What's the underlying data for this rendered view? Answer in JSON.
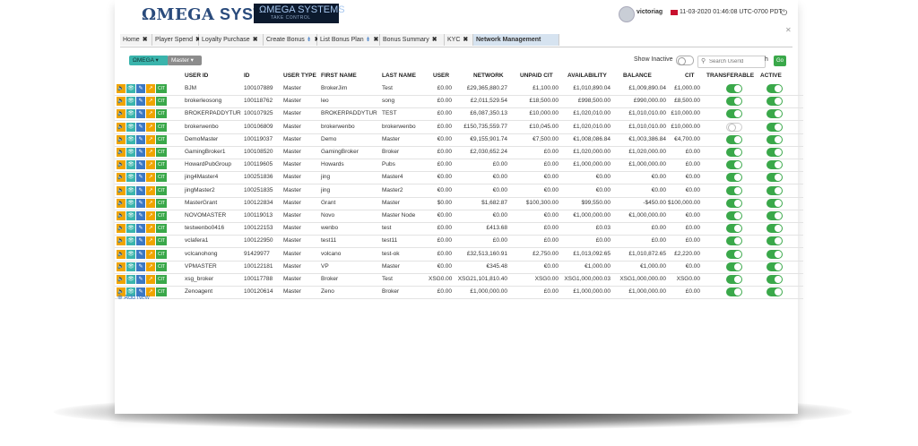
{
  "header": {
    "logo_text": "SYSTEMS",
    "logo_omega": "ΩMEGA",
    "badge_line1": "ΩMEGA SYSTEMS",
    "badge_line2": "TAKE CONTROL",
    "username": "victoriag",
    "datetime": "11-03-2020 01:46:08  UTC-0700 PDT",
    "power_icon": "⏻"
  },
  "tabs": [
    {
      "label": "Home",
      "pin": false,
      "active": false
    },
    {
      "label": "Player Spend",
      "pin": false,
      "active": false
    },
    {
      "label": "Loyalty Purchase",
      "pin": false,
      "active": false
    },
    {
      "label": "Create Bonus",
      "pin": true,
      "active": false
    },
    {
      "label": "List Bonus Plan",
      "pin": true,
      "active": false
    },
    {
      "label": "Bonus Summary",
      "pin": false,
      "active": false
    },
    {
      "label": "KYC",
      "pin": false,
      "active": false
    },
    {
      "label": "Network Management",
      "pin": false,
      "active": true
    }
  ],
  "toolbar": {
    "omega_dropdown": "ΩMEGA ▾",
    "master_dropdown": "Master ▾",
    "show_inactive": "Show Inactive",
    "search_placeholder": "Search UserId",
    "search_toggle": "h",
    "go_label": "Go"
  },
  "columns": [
    "USER ID",
    "ID",
    "USER TYPE",
    "FIRST NAME",
    "LAST NAME",
    "USER",
    "NETWORK",
    "UNPAID CIT",
    "AVAILABILITY",
    "BALANCE",
    "CIT",
    "TRANSFERABLE",
    "ACTIVE"
  ],
  "action_buttons": [
    "🔈",
    "👁",
    "✎",
    "↗",
    "CIT"
  ],
  "rows": [
    {
      "user_id": "BJM",
      "id": "100107889",
      "type": "Master",
      "first": "BrokerJim",
      "last": "Test",
      "user": "£0.00",
      "network": "£29,365,880.27",
      "unpaid": "£1,100.00",
      "avail": "£1,010,890.04",
      "balance": "£1,009,890.04",
      "cit": "£1,000.00",
      "transferable": true,
      "active": true
    },
    {
      "user_id": "brokerleosong",
      "id": "100118762",
      "type": "Master",
      "first": "leo",
      "last": "song",
      "user": "£0.00",
      "network": "£2,011,529.54",
      "unpaid": "£18,500.00",
      "avail": "£998,500.00",
      "balance": "£990,000.00",
      "cit": "£8,500.00",
      "transferable": true,
      "active": true
    },
    {
      "user_id": "BROKERPADDYTUR",
      "id": "100107925",
      "type": "Master",
      "first": "BROKERPADDYTUR",
      "last": "TEST",
      "user": "£0.00",
      "network": "£6,087,350.13",
      "unpaid": "£10,000.00",
      "avail": "£1,020,010.00",
      "balance": "£1,010,010.00",
      "cit": "£10,000.00",
      "transferable": true,
      "active": true
    },
    {
      "user_id": "brokerwenbo",
      "id": "100106809",
      "type": "Master",
      "first": "brokerwenbo",
      "last": "brokerwenbo",
      "user": "£0.00",
      "network": "£150,735,559.77",
      "unpaid": "£10,045.00",
      "avail": "£1,020,010.00",
      "balance": "£1,010,010.00",
      "cit": "£10,000.00",
      "transferable": false,
      "active": true
    },
    {
      "user_id": "DemoMaster",
      "id": "100119037",
      "type": "Master",
      "first": "Demo",
      "last": "Master",
      "user": "€0.00",
      "network": "€9,155,901.74",
      "unpaid": "€7,500.00",
      "avail": "€1,008,086.84",
      "balance": "€1,003,386.84",
      "cit": "€4,700.00",
      "transferable": true,
      "active": true
    },
    {
      "user_id": "GamingBroker1",
      "id": "100108520",
      "type": "Master",
      "first": "GamingBroker",
      "last": "Broker",
      "user": "£0.00",
      "network": "£2,030,652.24",
      "unpaid": "£0.00",
      "avail": "£1,020,000.00",
      "balance": "£1,020,000.00",
      "cit": "£0.00",
      "transferable": true,
      "active": true
    },
    {
      "user_id": "HowardPubGroup",
      "id": "100119605",
      "type": "Master",
      "first": "Howards",
      "last": "Pubs",
      "user": "£0.00",
      "network": "£0.00",
      "unpaid": "£0.00",
      "avail": "£1,000,000.00",
      "balance": "£1,000,000.00",
      "cit": "£0.00",
      "transferable": true,
      "active": true
    },
    {
      "user_id": "jing4Master4",
      "id": "100251836",
      "type": "Master",
      "first": "jing",
      "last": "Master4",
      "user": "€0.00",
      "network": "€0.00",
      "unpaid": "€0.00",
      "avail": "€0.00",
      "balance": "€0.00",
      "cit": "€0.00",
      "transferable": true,
      "active": true
    },
    {
      "user_id": "jingMaster2",
      "id": "100251835",
      "type": "Master",
      "first": "jing",
      "last": "Master2",
      "user": "€0.00",
      "network": "€0.00",
      "unpaid": "€0.00",
      "avail": "€0.00",
      "balance": "€0.00",
      "cit": "€0.00",
      "transferable": true,
      "active": true
    },
    {
      "user_id": "MasterGrant",
      "id": "100122834",
      "type": "Master",
      "first": "Grant",
      "last": "Master",
      "user": "$0.00",
      "network": "$1,682.87",
      "unpaid": "$100,300.00",
      "avail": "$99,550.00",
      "balance": "-$450.00",
      "cit": "$100,000.00",
      "transferable": true,
      "active": true
    },
    {
      "user_id": "NOVOMASTER",
      "id": "100119013",
      "type": "Master",
      "first": "Novo",
      "last": "Master Node",
      "user": "€0.00",
      "network": "€0.00",
      "unpaid": "€0.00",
      "avail": "€1,000,000.00",
      "balance": "€1,000,000.00",
      "cit": "€0.00",
      "transferable": true,
      "active": true
    },
    {
      "user_id": "testwenbo0416",
      "id": "100122153",
      "type": "Master",
      "first": "wenbo",
      "last": "test",
      "user": "£0.00",
      "network": "£413.68",
      "unpaid": "£0.00",
      "avail": "£0.03",
      "balance": "£0.00",
      "cit": "£0.00",
      "transferable": true,
      "active": true
    },
    {
      "user_id": "vclafera1",
      "id": "100122950",
      "type": "Master",
      "first": "test11",
      "last": "test11",
      "user": "£0.00",
      "network": "£0.00",
      "unpaid": "£0.00",
      "avail": "£0.00",
      "balance": "£0.00",
      "cit": "£0.00",
      "transferable": true,
      "active": true
    },
    {
      "user_id": "vclcanohong",
      "id": "91429977",
      "type": "Master",
      "first": "volcano",
      "last": "test-ok",
      "user": "£0.00",
      "network": "£32,513,160.91",
      "unpaid": "£2,750.00",
      "avail": "£1,013,092.65",
      "balance": "£1,010,872.65",
      "cit": "£2,220.00",
      "transferable": true,
      "active": true
    },
    {
      "user_id": "VPMASTER",
      "id": "100122181",
      "type": "Master",
      "first": "VP",
      "last": "Master",
      "user": "€0.00",
      "network": "€345.48",
      "unpaid": "€0.00",
      "avail": "€1,000.00",
      "balance": "€1,000.00",
      "cit": "€0.00",
      "transferable": true,
      "active": true
    },
    {
      "user_id": "xsg_broker",
      "id": "100117788",
      "type": "Master",
      "first": "Broker",
      "last": "Test",
      "user": "XSG0.00",
      "network": "XSG21,101,810.40",
      "unpaid": "XSG0.00",
      "avail": "XSG1,000,000.03",
      "balance": "XSG1,000,000.00",
      "cit": "XSG0.00",
      "transferable": true,
      "active": true
    },
    {
      "user_id": "Zenoagent",
      "id": "100120614",
      "type": "Master",
      "first": "Zeno",
      "last": "Broker",
      "user": "£0.00",
      "network": "£1,000,000.00",
      "unpaid": "£0.00",
      "avail": "£1,000,000.00",
      "balance": "£1,000,000.00",
      "cit": "£0.00",
      "transferable": true,
      "active": true
    }
  ],
  "add_new": "⊕ Add New",
  "colors": {
    "green": "#3aa84a",
    "teal": "#3ab4ac",
    "blue": "#3b78c4",
    "orange": "#f0a400",
    "brand": "#2a4b7c"
  }
}
